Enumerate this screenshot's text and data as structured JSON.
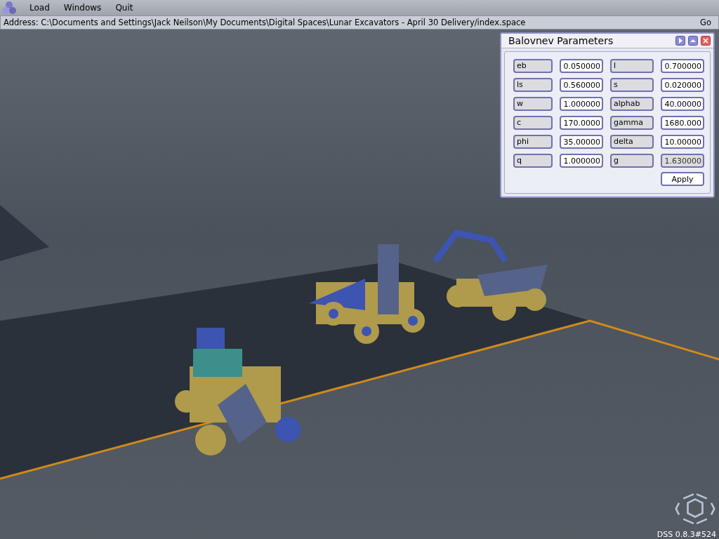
{
  "menu": [
    {
      "label": "Load"
    },
    {
      "label": "Windows"
    },
    {
      "label": "Quit"
    }
  ],
  "address_bar": {
    "text": "Address: C:\\Documents and Settings\\Jack Neilson\\My Documents\\Digital Spaces\\Lunar Excavators - April 30 Delivery/index.space",
    "go": "Go"
  },
  "dialog": {
    "title": "Balovnev Parameters",
    "params": [
      {
        "name": "eb",
        "value": "0.050000",
        "disabled": false
      },
      {
        "name": "l",
        "value": "0.700000",
        "disabled": false
      },
      {
        "name": "ls",
        "value": "0.560000",
        "disabled": false
      },
      {
        "name": "s",
        "value": "0.020000",
        "disabled": false
      },
      {
        "name": "w",
        "value": "1.000000",
        "disabled": false
      },
      {
        "name": "alphab",
        "value": "40.00000",
        "disabled": false
      },
      {
        "name": "c",
        "value": "170.0000",
        "disabled": false
      },
      {
        "name": "gamma",
        "value": "1680.000",
        "disabled": false
      },
      {
        "name": "phi",
        "value": "35.00000",
        "disabled": false
      },
      {
        "name": "delta",
        "value": "10.00000",
        "disabled": false
      },
      {
        "name": "q",
        "value": "1.000000",
        "disabled": false
      },
      {
        "name": "g",
        "value": "1.630000",
        "disabled": true
      }
    ],
    "apply": "Apply"
  },
  "status": "DSS 0.8.3#524"
}
